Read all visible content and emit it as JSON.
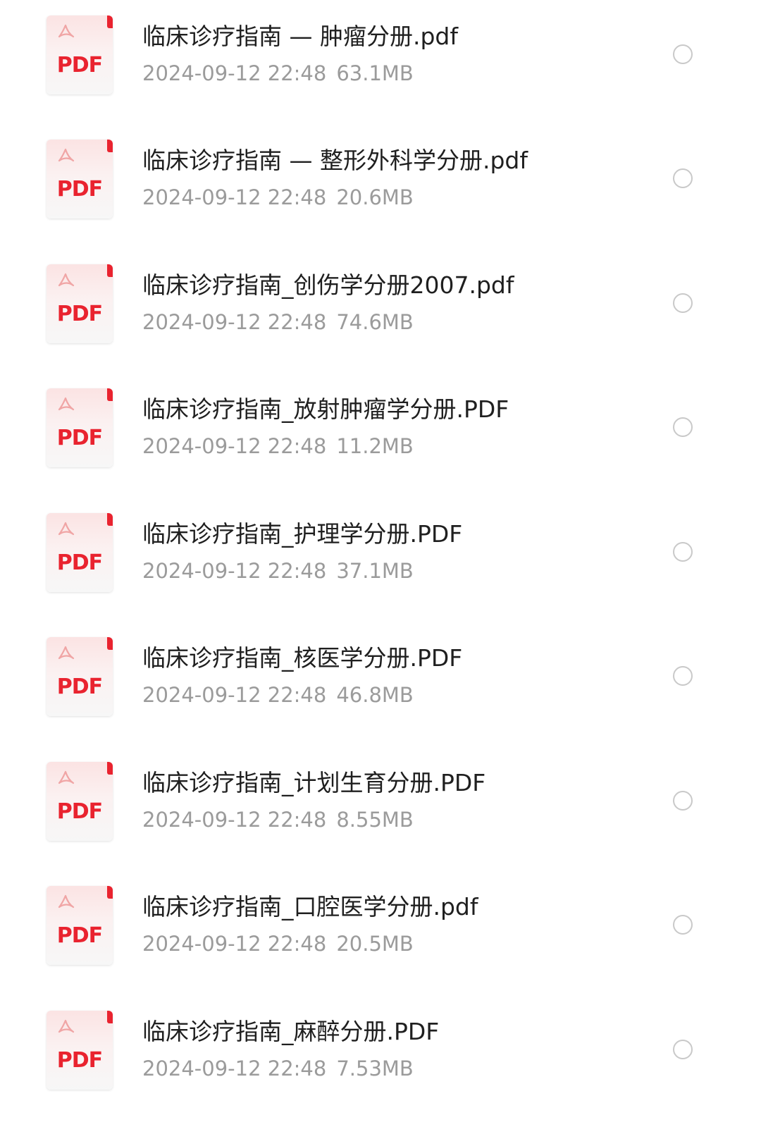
{
  "files": [
    {
      "name": "临床诊疗指南 — 肿瘤分册.pdf",
      "date": "2024-09-12 22:48",
      "size": "63.1MB",
      "icon": "pdf-file-icon",
      "icon_label": "PDF"
    },
    {
      "name": "临床诊疗指南 — 整形外科学分册.pdf",
      "date": "2024-09-12 22:48",
      "size": "20.6MB",
      "icon": "pdf-file-icon",
      "icon_label": "PDF"
    },
    {
      "name": "临床诊疗指南_创伤学分册2007.pdf",
      "date": "2024-09-12 22:48",
      "size": "74.6MB",
      "icon": "pdf-file-icon",
      "icon_label": "PDF"
    },
    {
      "name": "临床诊疗指南_放射肿瘤学分册.PDF",
      "date": "2024-09-12 22:48",
      "size": "11.2MB",
      "icon": "pdf-file-icon",
      "icon_label": "PDF"
    },
    {
      "name": "临床诊疗指南_护理学分册.PDF",
      "date": "2024-09-12 22:48",
      "size": "37.1MB",
      "icon": "pdf-file-icon",
      "icon_label": "PDF"
    },
    {
      "name": "临床诊疗指南_核医学分册.PDF",
      "date": "2024-09-12 22:48",
      "size": "46.8MB",
      "icon": "pdf-file-icon",
      "icon_label": "PDF"
    },
    {
      "name": "临床诊疗指南_计划生育分册.PDF",
      "date": "2024-09-12 22:48",
      "size": "8.55MB",
      "icon": "pdf-file-icon",
      "icon_label": "PDF"
    },
    {
      "name": "临床诊疗指南_口腔医学分册.pdf",
      "date": "2024-09-12 22:48",
      "size": "20.5MB",
      "icon": "pdf-file-icon",
      "icon_label": "PDF"
    },
    {
      "name": "临床诊疗指南_麻醉分册.PDF",
      "date": "2024-09-12 22:48",
      "size": "7.53MB",
      "icon": "pdf-file-icon",
      "icon_label": "PDF"
    }
  ],
  "colors": {
    "pdf_accent": "#e9232f",
    "name_text": "#1f1f1f",
    "meta_text": "#9b9b9b",
    "radio_border": "#c9c9c9"
  }
}
